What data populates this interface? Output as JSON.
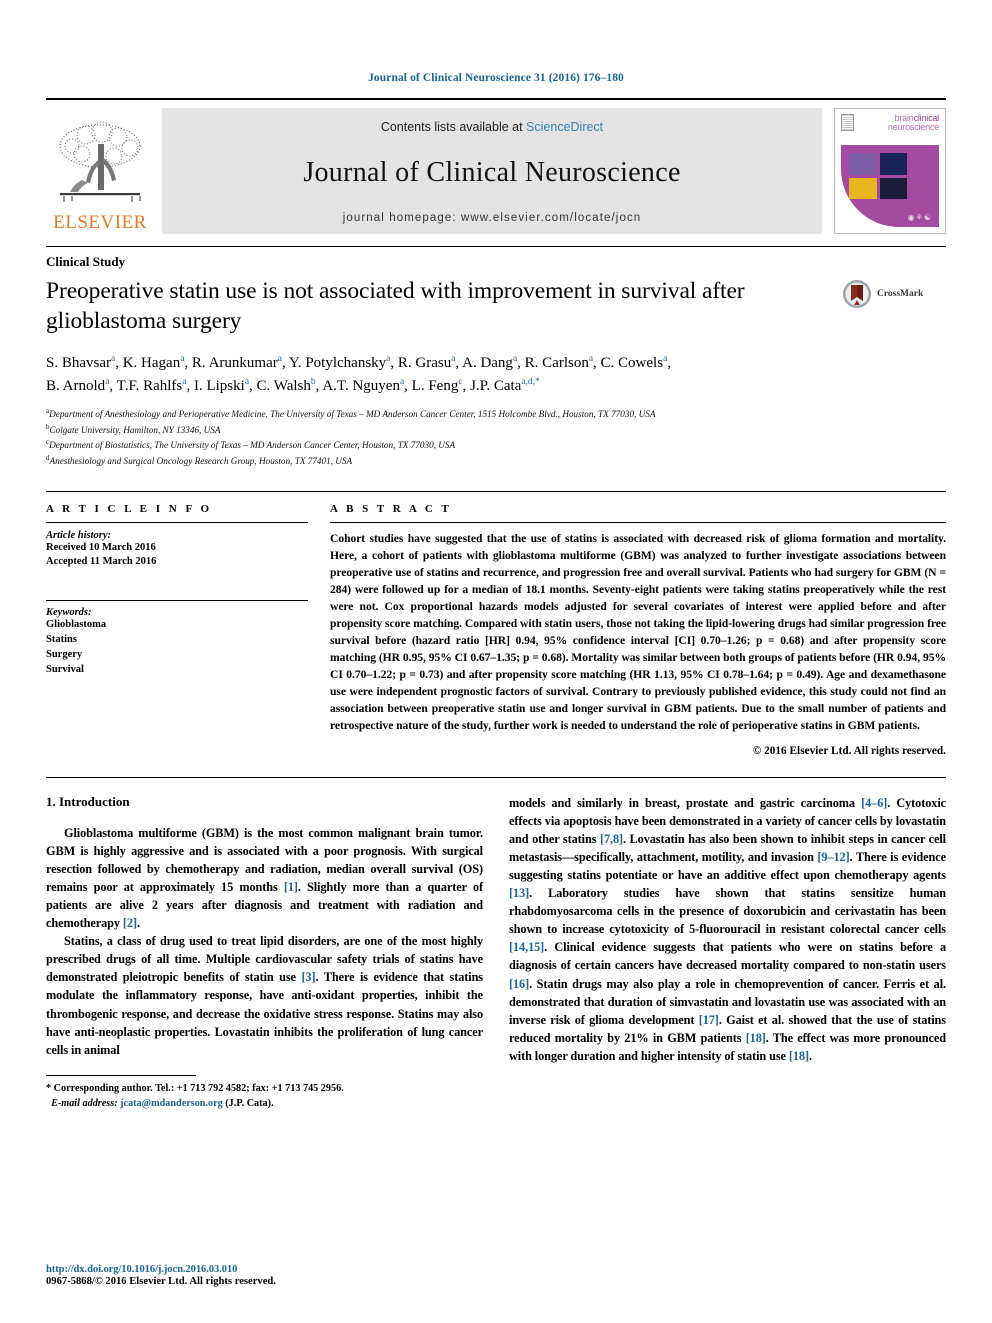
{
  "running_head": "Journal of Clinical Neuroscience 31 (2016) 176–180",
  "masthead": {
    "contents_prefix": "Contents lists available at ",
    "sciencedirect": "ScienceDirect",
    "journal_name": "Journal of Clinical Neuroscience",
    "homepage": "journal homepage: www.elsevier.com/locate/jocn",
    "publisher": "ELSEVIER",
    "cover": {
      "title_line1": "clinical",
      "title_line1_prefix": "brain",
      "title_line2": "neuroscience"
    }
  },
  "article": {
    "section_kind": "Clinical Study",
    "title": "Preoperative statin use is not associated with improvement in survival after glioblastoma surgery",
    "crossmark_label": "CrossMark",
    "authors_line1": [
      {
        "name": "S. Bhavsar",
        "sup": "a"
      },
      {
        "name": "K. Hagan",
        "sup": "a"
      },
      {
        "name": "R. Arunkumar",
        "sup": "a"
      },
      {
        "name": "Y. Potylchansky",
        "sup": "a"
      },
      {
        "name": "R. Grasu",
        "sup": "a"
      },
      {
        "name": "A. Dang",
        "sup": "a"
      },
      {
        "name": "R. Carlson",
        "sup": "a"
      },
      {
        "name": "C. Cowels",
        "sup": "a"
      }
    ],
    "authors_line2": [
      {
        "name": "B. Arnold",
        "sup": "a"
      },
      {
        "name": "T.F. Rahlfs",
        "sup": "a"
      },
      {
        "name": "I. Lipski",
        "sup": "a"
      },
      {
        "name": "C. Walsh",
        "sup": "b"
      },
      {
        "name": "A.T. Nguyen",
        "sup": "a"
      },
      {
        "name": "L. Feng",
        "sup": "c"
      },
      {
        "name": "J.P. Cata",
        "sup": "a,d,*"
      }
    ],
    "affiliations": [
      {
        "marker": "a",
        "text": "Department of Anesthesiology and Perioperative Medicine, The University of Texas – MD Anderson Cancer Center, 1515 Holcombe Blvd., Houston, TX 77030, USA"
      },
      {
        "marker": "b",
        "text": "Colgate University, Hamilton, NY 13346, USA"
      },
      {
        "marker": "c",
        "text": "Department of Biostatistics, The University of Texas – MD Anderson Cancer Center, Houston, TX 77030, USA"
      },
      {
        "marker": "d",
        "text": "Anesthesiology and Surgical Oncology Research Group, Houston, TX 77401, USA"
      }
    ]
  },
  "article_info": {
    "heading": "A R T I C L E    I N F O",
    "history_label": "Article history:",
    "history": [
      "Received 10 March 2016",
      "Accepted 11 March 2016"
    ],
    "keywords_label": "Keywords:",
    "keywords": [
      "Glioblastoma",
      "Statins",
      "Surgery",
      "Survival"
    ]
  },
  "abstract": {
    "heading": "A B S T R A C T",
    "text": "Cohort studies have suggested that the use of statins is associated with decreased risk of glioma formation and mortality. Here, a cohort of patients with glioblastoma multiforme (GBM) was analyzed to further investigate associations between preoperative use of statins and recurrence, and progression free and overall survival. Patients who had surgery for GBM (N = 284) were followed up for a median of 18.1 months. Seventy-eight patients were taking statins preoperatively while the rest were not. Cox proportional hazards models adjusted for several covariates of interest were applied before and after propensity score matching. Compared with statin users, those not taking the lipid-lowering drugs had similar progression free survival before (hazard ratio [HR] 0.94, 95% confidence interval [CI] 0.70–1.26; p = 0.68) and after propensity score matching (HR 0.95, 95% CI 0.67–1.35; p = 0.68). Mortality was similar between both groups of patients before (HR 0.94, 95% CI 0.70–1.22; p = 0.73) and after propensity score matching (HR 1.13, 95% CI 0.78–1.64; p = 0.49). Age and dexamethasone use were independent prognostic factors of survival. Contrary to previously published evidence, this study could not find an association between preoperative statin use and longer survival in GBM patients. Due to the small number of patients and retrospective nature of the study, further work is needed to understand the role of perioperative statins in GBM patients.",
    "copyright": "© 2016 Elsevier Ltd. All rights reserved."
  },
  "body": {
    "intro_heading": "1. Introduction",
    "para1_a": "Glioblastoma multiforme (GBM) is the most common malignant brain tumor. GBM is highly aggressive and is associated with a poor prognosis. With surgical resection followed by chemotherapy and radiation, median overall survival (OS) remains poor at approximately 15 months ",
    "para1_cite1": "[1]",
    "para1_b": ". Slightly more than a quarter of patients are alive 2 years after diagnosis and treatment with radiation and chemotherapy ",
    "para1_cite2": "[2]",
    "para1_c": ".",
    "para2_a": "Statins, a class of drug used to treat lipid disorders, are one of the most highly prescribed drugs of all time. Multiple cardiovascular safety trials of statins have demonstrated pleiotropic benefits of statin use ",
    "para2_cite1": "[3]",
    "para2_b": ". There is evidence that statins modulate the inflammatory response, have anti-oxidant properties, inhibit the thrombogenic response, and decrease the oxidative stress response. Statins may also have anti-neoplastic properties. Lovastatin inhibits the proliferation of lung cancer cells in animal",
    "para3_a": "models and similarly in breast, prostate and gastric carcinoma ",
    "para3_cite1": "[4–6]",
    "para3_b": ". Cytotoxic effects via apoptosis have been demonstrated in a variety of cancer cells by lovastatin and other statins ",
    "para3_cite2": "[7,8]",
    "para3_c": ". Lovastatin has also been shown to inhibit steps in cancer cell metastasis—specifically, attachment, motility, and invasion ",
    "para3_cite3": "[9–12]",
    "para3_d": ". There is evidence suggesting statins potentiate or have an additive effect upon chemotherapy agents ",
    "para3_cite4": "[13]",
    "para3_e": ". Laboratory studies have shown that statins sensitize human rhabdomyosarcoma cells in the presence of doxorubicin and cerivastatin has been shown to increase cytotoxicity of 5-fluorouracil in resistant colorectal cancer cells ",
    "para3_cite5": "[14,15]",
    "para3_f": ". Clinical evidence suggests that patients who were on statins before a diagnosis of certain cancers have decreased mortality compared to non-statin users ",
    "para3_cite6": "[16]",
    "para3_g": ". Statin drugs may also play a role in chemoprevention of cancer. Ferris et al. demonstrated that duration of simvastatin and lovastatin use was associated with an inverse risk of glioma development ",
    "para3_cite7": "[17]",
    "para3_h": ". Gaist et al. showed that the use of statins reduced mortality by 21% in GBM patients ",
    "para3_cite8": "[18]",
    "para3_i": ". The effect was more pronounced with longer duration and higher intensity of statin use ",
    "para3_cite9": "[18]",
    "para3_j": "."
  },
  "footnote": {
    "star": "*",
    "corresponding": "Corresponding author. Tel.: +1 713 792 4582; fax: +1 713 745 2956.",
    "email_label": "E-mail address:",
    "email": "jcata@mdanderson.org",
    "email_suffix": "(J.P. Cata)."
  },
  "footer": {
    "doi": "http://dx.doi.org/10.1016/j.jocn.2016.03.010",
    "issn": "0967-5868/© 2016 Elsevier Ltd. All rights reserved."
  },
  "colors": {
    "link": "#1a6496",
    "elsevier_orange": "#E87722",
    "cover_purple": "#a44aa0",
    "crossmark_red": "#8f2a20"
  }
}
